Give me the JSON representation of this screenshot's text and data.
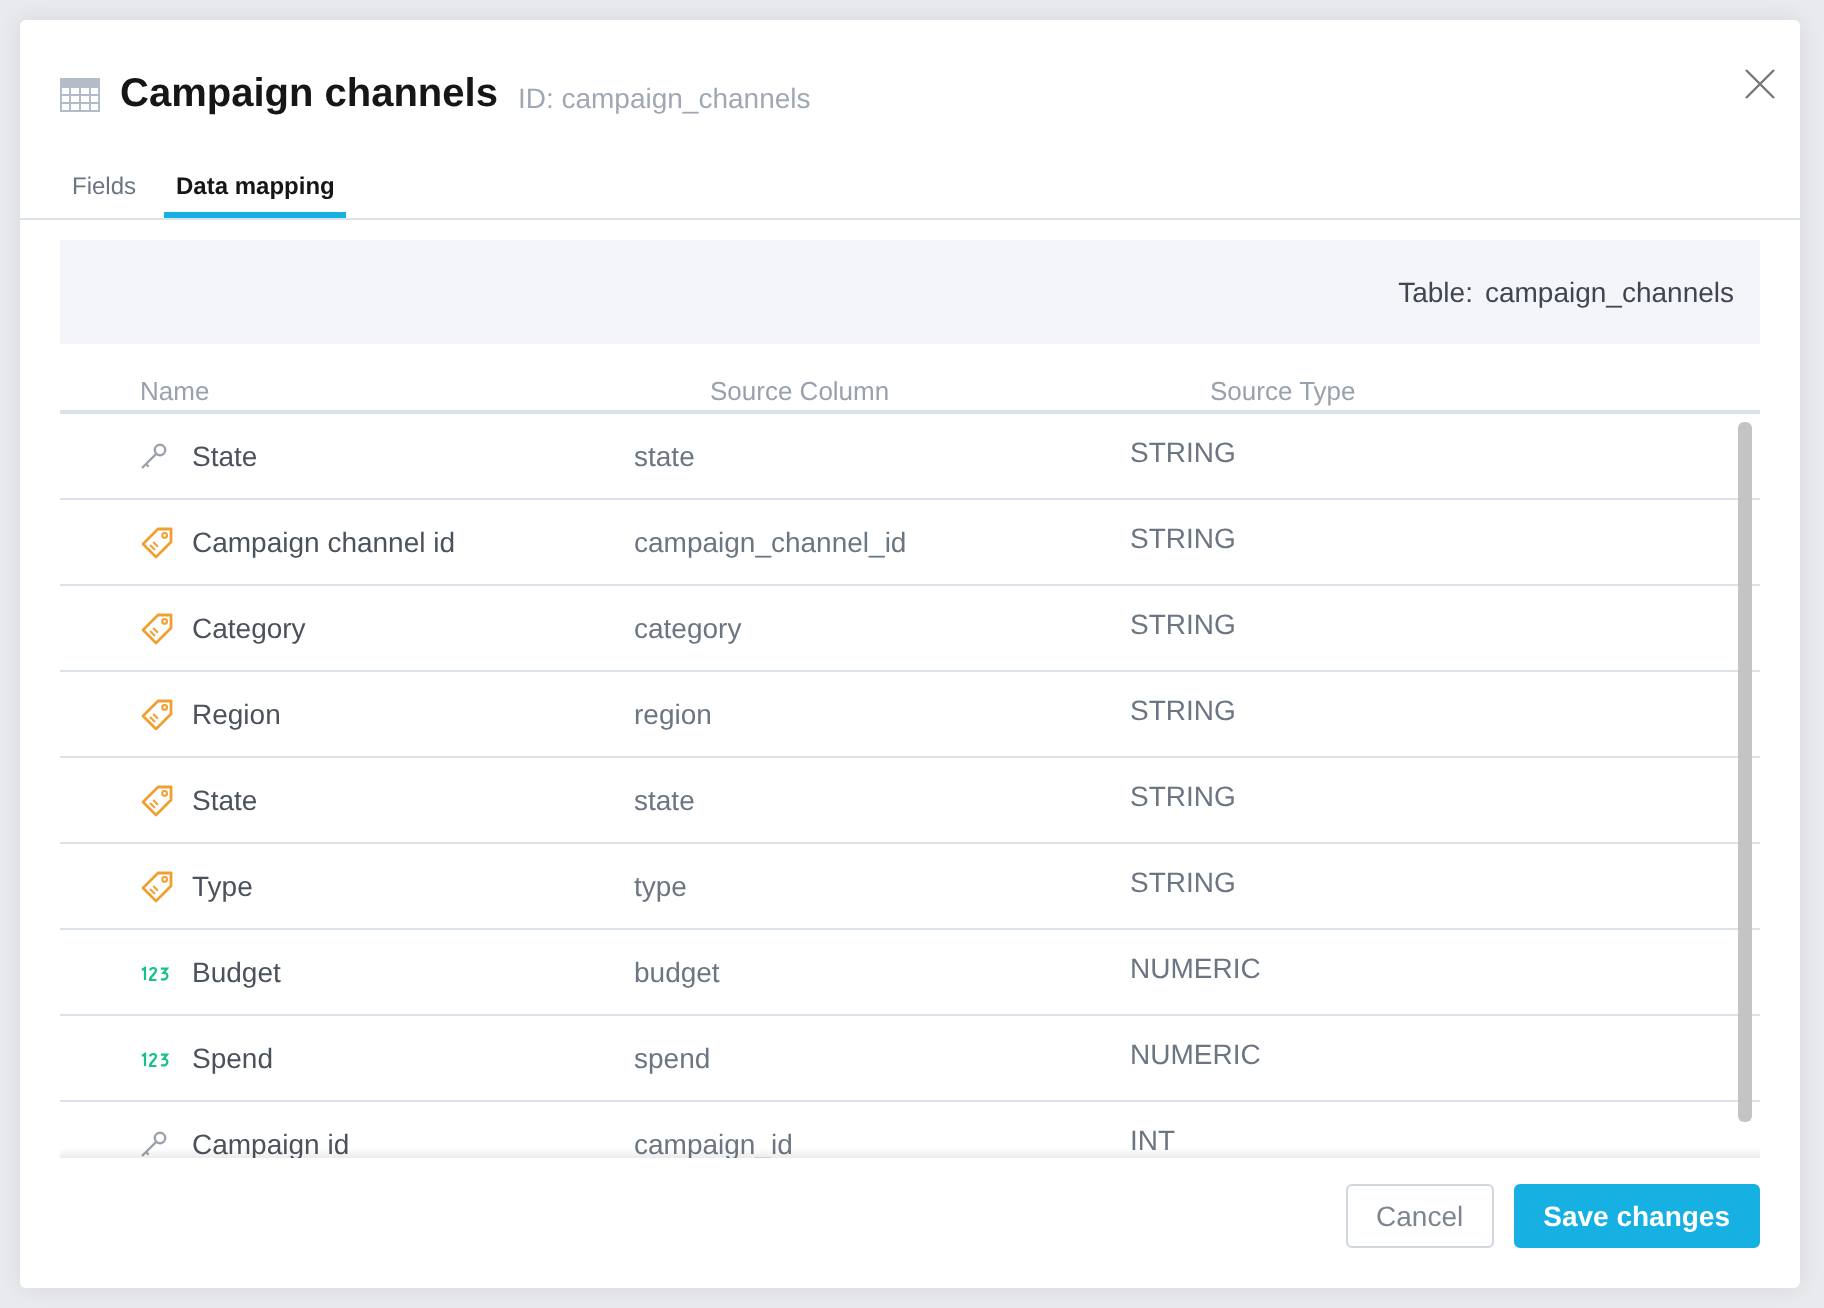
{
  "dialog": {
    "title": "Campaign channels",
    "id_label": "ID: campaign_channels"
  },
  "tabs": [
    {
      "label": "Fields",
      "selected": false
    },
    {
      "label": "Data mapping",
      "selected": true
    }
  ],
  "table_info": {
    "label": "Table:",
    "value": "campaign_channels"
  },
  "columns": [
    "Name",
    "Source Column",
    "Source Type"
  ],
  "rows": [
    {
      "kind": "key",
      "name": "State",
      "source_column": "state",
      "source_type": "STRING"
    },
    {
      "kind": "dimension",
      "name": "Campaign channel id",
      "source_column": "campaign_channel_id",
      "source_type": "STRING"
    },
    {
      "kind": "dimension",
      "name": "Category",
      "source_column": "category",
      "source_type": "STRING"
    },
    {
      "kind": "dimension",
      "name": "Region",
      "source_column": "region",
      "source_type": "STRING"
    },
    {
      "kind": "dimension",
      "name": "State",
      "source_column": "state",
      "source_type": "STRING"
    },
    {
      "kind": "dimension",
      "name": "Type",
      "source_column": "type",
      "source_type": "STRING"
    },
    {
      "kind": "numeric",
      "name": "Budget",
      "source_column": "budget",
      "source_type": "NUMERIC"
    },
    {
      "kind": "numeric",
      "name": "Spend",
      "source_column": "spend",
      "source_type": "NUMERIC"
    },
    {
      "kind": "key",
      "name": "Campaign id",
      "source_column": "campaign_id",
      "source_type": "INT"
    }
  ],
  "buttons": [
    {
      "kind": "secondary",
      "label": "Cancel"
    },
    {
      "kind": "primary",
      "label": "Save changes"
    }
  ]
}
